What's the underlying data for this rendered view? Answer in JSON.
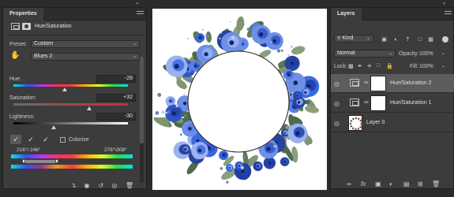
{
  "properties": {
    "tab_label": "Properties",
    "adjustment_title": "Hue/Saturation",
    "preset_label": "Preset:",
    "preset_value": "Custom",
    "channel_value": "Blues 2",
    "hue_label": "Hue:",
    "hue_value": "-28",
    "hue_fraction": 0.45,
    "saturation_label": "Saturation:",
    "saturation_value": "+32",
    "saturation_fraction": 0.66,
    "lightness_label": "Lightness:",
    "lightness_value": "-30",
    "lightness_fraction": 0.35,
    "colorize_label": "Colorize",
    "range_left": "216°/ 246°",
    "range_right": "276°\\308°"
  },
  "layers": {
    "tab_label": "Layers",
    "kind_value": "Kind",
    "blend_mode": "Normal",
    "opacity_label": "Opacity:",
    "opacity_value": "100%",
    "lock_label": "Lock:",
    "fill_label": "Fill:",
    "fill_value": "100%",
    "items": [
      {
        "name": "Hue/Saturation 2",
        "selected": true
      },
      {
        "name": "Hue/Saturation 1",
        "selected": false
      },
      {
        "name": "Layer 0",
        "selected": false
      }
    ]
  },
  "icons": {
    "visibility": "eye-icon",
    "link": "chain-link-icon",
    "targeted_adjustment": "hand-icon",
    "eyedroppers": [
      "eyedropper-icon",
      "eyedropper-plus-icon",
      "eyedropper-minus-icon"
    ]
  },
  "colors": {
    "panel_bg": "#3c3c3c",
    "selected_row": "#5c5c5c",
    "canvas_bg": "#ffffff",
    "flower_blue": "#2f55c8"
  }
}
